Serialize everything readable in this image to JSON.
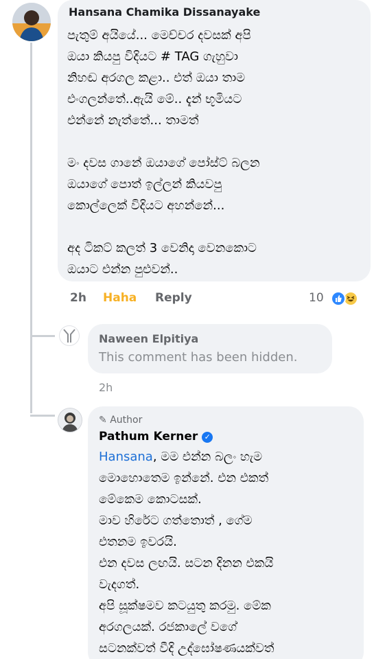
{
  "comments": [
    {
      "author": "Hansana Chamika Dissanayake",
      "lines": [
        "පැතුම් අයියේ... මෙච්චර දවසක් අපි",
        "ඔයා කියපු විදියට # TAG ගැහුවා",
        "නිහඬ අරගල කළා.. එත් ඔයා තාම",
        "එංගලන්තේ..ඇයි මේ.. දැන් භූමියට",
        "එන්නේ නැත්තේ... තාමත්",
        "",
        "මං දවස ගානේ ඔයාගේ පෝස්ට් බලන",
        "ඔයාගේ පොත් ඉල්ලන් කියවපු",
        "කොල්ලෙක් විදියට අහන්නේ...",
        "",
        "අද ටිකට් කලත් 3 වෙනිදා වෙනකොට",
        "ඔයාට එන්න පුළුවන්.."
      ],
      "time": "2h",
      "reaction_label": "Haha",
      "reply_label": "Reply",
      "reaction_count": "10",
      "reaction_icons": [
        "like-icon",
        "haha-icon"
      ]
    },
    {
      "author": "Naween Elpitiya",
      "text": "This comment has been hidden.",
      "time": "2h"
    },
    {
      "badge": "Author",
      "author": "Pathum Kerner",
      "verified": true,
      "mention": "Hansana",
      "first_line_rest": ", මම එන්න බලං හැම",
      "lines": [
        "මොහොතෙම ඉන්නේ. එන එකත්",
        "මේකෙම කොටසක්.",
        "මාව හිරේට ගත්තොත් , ගේම",
        "එතනම ඉවරයි.",
        "එන දවස ලඟයි. සටන දිනන එකයි",
        "වැදගත්.",
        "අපි සූක්ෂමව කටයුතු කරමු. මේක",
        "අරගලයක්. රජකාලේ වගේ",
        "සටනක්වත් වීදි උද්ඝෝෂණයක්වත්"
      ]
    }
  ],
  "colors": {
    "bubble": "#f0f2f5",
    "haha": "#f7b125",
    "mention": "#1d6fd6",
    "verified": "#1877f2"
  }
}
